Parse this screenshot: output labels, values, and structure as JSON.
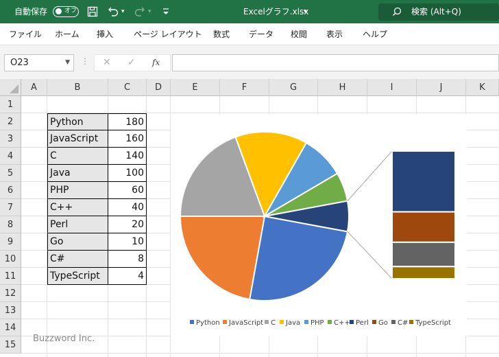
{
  "titlebar": {
    "autosave_label": "自動保存",
    "autosave_state": "オフ",
    "filename": "Excelグラフ.xlsx",
    "search_label": "検索 (Alt+Q)",
    "background_color": "#217346"
  },
  "ribbon_tabs": [
    "ファイル",
    "ホーム",
    "挿入",
    "ページ レイアウト",
    "数式",
    "データ",
    "校閲",
    "表示",
    "ヘルプ"
  ],
  "formula_bar": {
    "name_box": "O23",
    "fx_label": "fx",
    "formula": ""
  },
  "columns": [
    "A",
    "B",
    "C",
    "D",
    "E",
    "F",
    "G",
    "H",
    "I",
    "J",
    "K"
  ],
  "rows": [
    "1",
    "2",
    "3",
    "4",
    "5",
    "6",
    "7",
    "8",
    "9",
    "10",
    "11",
    "12",
    "13",
    "14",
    "15"
  ],
  "table": [
    {
      "label": "Python",
      "value": "180"
    },
    {
      "label": "JavaScript",
      "value": "160"
    },
    {
      "label": "C",
      "value": "140"
    },
    {
      "label": "Java",
      "value": "100"
    },
    {
      "label": "PHP",
      "value": "60"
    },
    {
      "label": "C++",
      "value": "40"
    },
    {
      "label": "Perl",
      "value": "20"
    },
    {
      "label": "Go",
      "value": "10"
    },
    {
      "label": "C#",
      "value": "8"
    },
    {
      "label": "TypeScript",
      "value": "4"
    }
  ],
  "chart_data": {
    "type": "pie",
    "subtype": "bar-of-pie",
    "categories": [
      "Python",
      "JavaScript",
      "C",
      "Java",
      "PHP",
      "C++",
      "Perl",
      "Go",
      "C#",
      "TypeScript"
    ],
    "values": [
      180,
      160,
      140,
      100,
      60,
      40,
      20,
      10,
      8,
      4
    ],
    "colors": [
      "#4472C4",
      "#ED7D31",
      "#A5A5A5",
      "#FFC000",
      "#5B9BD5",
      "#70AD47",
      "#264478",
      "#9E480E",
      "#636363",
      "#997300"
    ],
    "secondary_plot_categories": [
      "Perl",
      "Go",
      "C#",
      "TypeScript"
    ],
    "legend_position": "bottom",
    "title": ""
  },
  "watermark": "Buzzword Inc."
}
